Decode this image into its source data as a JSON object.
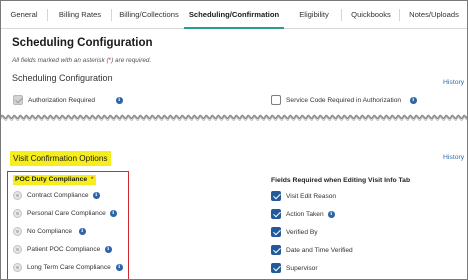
{
  "tabs": [
    {
      "label": "General",
      "active": false
    },
    {
      "label": "Billing Rates",
      "active": false
    },
    {
      "label": "Billing/Collections",
      "active": false
    },
    {
      "label": "Scheduling/Confirmation",
      "active": true
    },
    {
      "label": "Eligibility",
      "active": false
    },
    {
      "label": "Quickbooks",
      "active": false
    },
    {
      "label": "Notes/Uploads",
      "active": false
    }
  ],
  "page": {
    "title": "Scheduling Configuration",
    "note_prefix": "All fields marked with an asterisk (",
    "note_asterisk": "*",
    "note_suffix": ") are required.",
    "section1_title": "Scheduling Configuration",
    "history_label": "History"
  },
  "scheduling": {
    "authorization_required": {
      "label": "Authorization Required",
      "checked": true,
      "disabled": true
    },
    "service_code_required": {
      "label": "Service Code Required in Authorization",
      "checked": false
    }
  },
  "visit_confirmation": {
    "title": "Visit Confirmation Options",
    "history_label": "History",
    "poc_title": "POC Duty Compliance",
    "poc_asterisk": "*",
    "poc_options": [
      {
        "label": "Contract Compliance"
      },
      {
        "label": "Personal Care Compliance"
      },
      {
        "label": "No Compliance"
      },
      {
        "label": "Patient POC Compliance"
      },
      {
        "label": "Long Term Care Compliance"
      }
    ],
    "fields_title": "Fields Required when Editing Visit Info Tab",
    "fields": [
      {
        "label": "Visit Edit Reason",
        "checked": true
      },
      {
        "label": "Action Taken",
        "checked": true
      },
      {
        "label": "Verified By",
        "checked": true
      },
      {
        "label": "Date and Time Verified",
        "checked": true
      },
      {
        "label": "Supervisor",
        "checked": true
      }
    ]
  },
  "colors": {
    "accent_tab": "#2a9d8f",
    "checkbox_blue": "#235b9a",
    "info_blue": "#2e65aa",
    "highlight_yellow": "#f6ee1c",
    "box_red": "#d1292c"
  }
}
